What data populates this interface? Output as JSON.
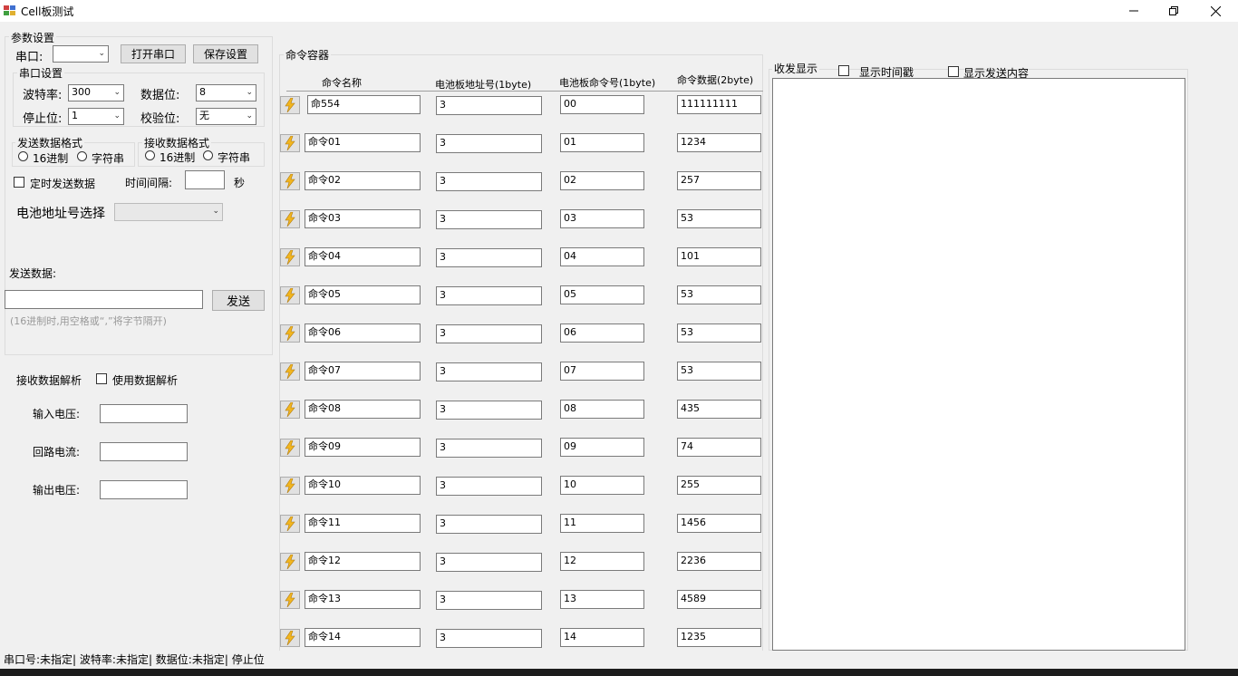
{
  "window": {
    "title": "Cell板测试",
    "minimize_icon": "minimize-icon",
    "restore_icon": "restore-icon",
    "close_icon": "close-icon"
  },
  "params": {
    "group_title": "参数设置",
    "port_label": "串口:",
    "port_value": "",
    "open_port_button": "打开串口",
    "save_settings_button": "保存设置",
    "serial_group_title": "串口设置",
    "baud_label": "波特率:",
    "baud_value": "300",
    "databits_label": "数据位:",
    "databits_value": "8",
    "stopbits_label": "停止位:",
    "stopbits_value": "1",
    "parity_label": "校验位:",
    "parity_value": "无",
    "send_format_title": "发送数据格式",
    "send_hex_label": "16进制",
    "send_str_label": "字符串",
    "recv_format_title": "接收数据格式",
    "recv_hex_label": "16进制",
    "recv_str_label": "字符串",
    "timed_send_label": "定时发送数据",
    "interval_label": "时间间隔:",
    "interval_value": "",
    "interval_unit": "秒",
    "battery_addr_label": "电池地址号选择",
    "battery_addr_value": "",
    "send_data_label": "发送数据:",
    "send_data_value": "",
    "send_button": "发送",
    "send_hint": "(16进制时,用空格或“,”将字节隔开)"
  },
  "parse": {
    "title": "接收数据解析",
    "use_parse_label": "使用数据解析",
    "input_voltage_label": "输入电压:",
    "input_voltage_value": "",
    "loop_current_label": "回路电流:",
    "loop_current_value": "",
    "output_voltage_label": "输出电压:",
    "output_voltage_value": ""
  },
  "commands": {
    "group_title": "命令容器",
    "headers": {
      "name": "命令名称",
      "addr": "电池板地址号(1byte)",
      "cmd": "电池板命令号(1byte)",
      "data": "命令数据(2byte)"
    },
    "button_icon": "lightning-icon",
    "rows": [
      {
        "name": "命554",
        "addr": "3",
        "cmd": "00",
        "data": "111111111"
      },
      {
        "name": "命令01",
        "addr": "3",
        "cmd": "01",
        "data": "1234"
      },
      {
        "name": "命令02",
        "addr": "3",
        "cmd": "02",
        "data": "257"
      },
      {
        "name": "命令03",
        "addr": "3",
        "cmd": "03",
        "data": "53"
      },
      {
        "name": "命令04",
        "addr": "3",
        "cmd": "04",
        "data": "101"
      },
      {
        "name": "命令05",
        "addr": "3",
        "cmd": "05",
        "data": "53"
      },
      {
        "name": "命令06",
        "addr": "3",
        "cmd": "06",
        "data": "53"
      },
      {
        "name": "命令07",
        "addr": "3",
        "cmd": "07",
        "data": "53"
      },
      {
        "name": "命令08",
        "addr": "3",
        "cmd": "08",
        "data": "435"
      },
      {
        "name": "命令09",
        "addr": "3",
        "cmd": "09",
        "data": "74"
      },
      {
        "name": "命令10",
        "addr": "3",
        "cmd": "10",
        "data": "255"
      },
      {
        "name": "命令11",
        "addr": "3",
        "cmd": "11",
        "data": "1456"
      },
      {
        "name": "命令12",
        "addr": "3",
        "cmd": "12",
        "data": "2236"
      },
      {
        "name": "命令13",
        "addr": "3",
        "cmd": "13",
        "data": "4589"
      },
      {
        "name": "命令14",
        "addr": "3",
        "cmd": "14",
        "data": "1235"
      }
    ]
  },
  "display": {
    "group_title": "收发显示",
    "show_timestamp_label": "显示时间戳",
    "show_sent_label": "显示发送内容"
  },
  "status": {
    "text": "串口号:未指定| 波特率:未指定| 数据位:未指定| 停止位"
  }
}
